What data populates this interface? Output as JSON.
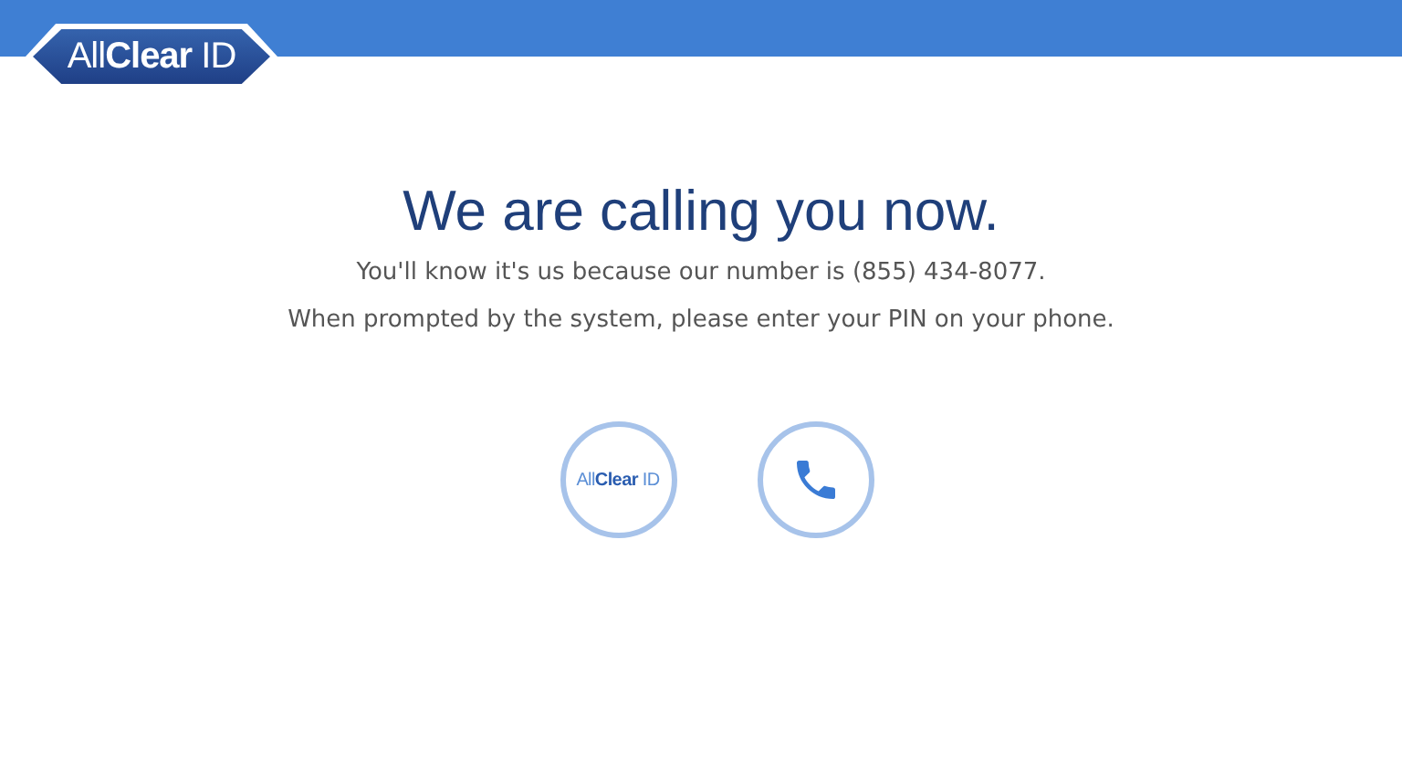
{
  "header": {
    "logo": "All**Clear** ID"
  },
  "message": {
    "title": "We are calling you now.",
    "lines": [
      "You'll know it's us because our number is (855) 434-8077.",
      "When prompted by the system, please enter your PIN on your phone."
    ]
  },
  "call_graphic": {
    "logo": "All**Clear** ID"
  }
}
